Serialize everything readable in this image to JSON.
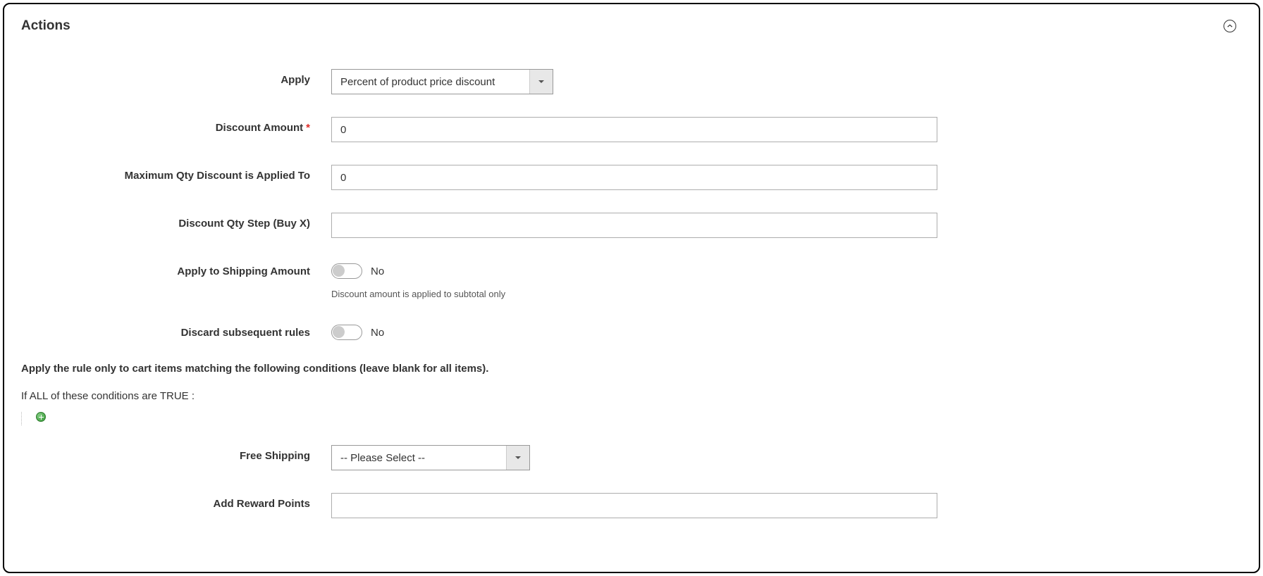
{
  "panel": {
    "title": "Actions"
  },
  "fields": {
    "apply": {
      "label": "Apply",
      "value": "Percent of product price discount"
    },
    "discount_amount": {
      "label": "Discount Amount",
      "value": "0"
    },
    "max_qty": {
      "label": "Maximum Qty Discount is Applied To",
      "value": "0"
    },
    "qty_step": {
      "label": "Discount Qty Step (Buy X)",
      "value": ""
    },
    "apply_shipping": {
      "label": "Apply to Shipping Amount",
      "state": "No",
      "help": "Discount amount is applied to subtotal only"
    },
    "discard_rules": {
      "label": "Discard subsequent rules",
      "state": "No"
    },
    "free_shipping": {
      "label": "Free Shipping",
      "value": "-- Please Select --"
    },
    "reward_points": {
      "label": "Add Reward Points",
      "value": ""
    }
  },
  "conditions": {
    "title": "Apply the rule only to cart items matching the following conditions (leave blank for all items).",
    "line_prefix": "If ",
    "aggregator": "ALL",
    "line_mid": " of these conditions are ",
    "value": "TRUE",
    "line_suffix": " :"
  }
}
